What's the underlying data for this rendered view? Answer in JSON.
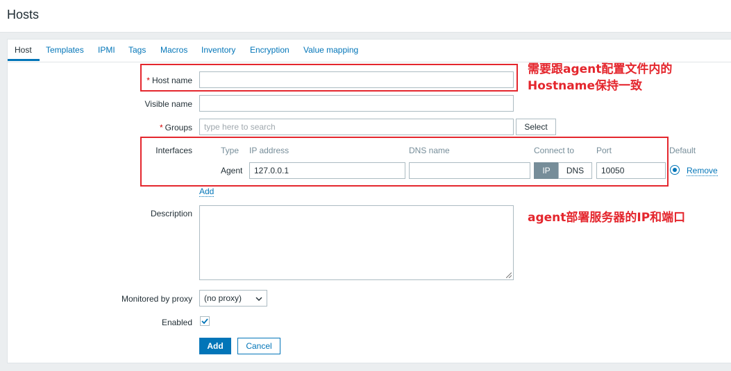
{
  "header": {
    "title": "Hosts"
  },
  "tabs": [
    {
      "label": "Host"
    },
    {
      "label": "Templates"
    },
    {
      "label": "IPMI"
    },
    {
      "label": "Tags"
    },
    {
      "label": "Macros"
    },
    {
      "label": "Inventory"
    },
    {
      "label": "Encryption"
    },
    {
      "label": "Value mapping"
    }
  ],
  "form": {
    "required_mark": "*",
    "host_name_label": "Host name",
    "host_name_value": "",
    "visible_name_label": "Visible name",
    "visible_name_value": "",
    "groups_label": "Groups",
    "groups_placeholder": "type here to search",
    "select_button": "Select",
    "interfaces_label": "Interfaces",
    "interfaces_headers": {
      "type": "Type",
      "ip": "IP address",
      "dns": "DNS name",
      "connect_to": "Connect to",
      "port": "Port",
      "default": "Default"
    },
    "interface_row": {
      "type": "Agent",
      "ip": "127.0.0.1",
      "dns": "",
      "connect_ip": "IP",
      "connect_dns": "DNS",
      "port": "10050",
      "remove": "Remove"
    },
    "add_interface": "Add",
    "description_label": "Description",
    "description_value": "",
    "proxy_label": "Monitored by proxy",
    "proxy_value": "(no proxy)",
    "enabled_label": "Enabled",
    "enabled": true,
    "add_button": "Add",
    "cancel_button": "Cancel"
  },
  "annotations": {
    "host_name_note_line1": "需要跟agent配置文件内的",
    "host_name_note_line2": "Hostname保持一致",
    "interfaces_note": "agent部署服务器的IP和端口"
  },
  "colors": {
    "accent": "#0275b8",
    "annotation_red": "#e4262d",
    "toggle_active": "#768d99"
  }
}
